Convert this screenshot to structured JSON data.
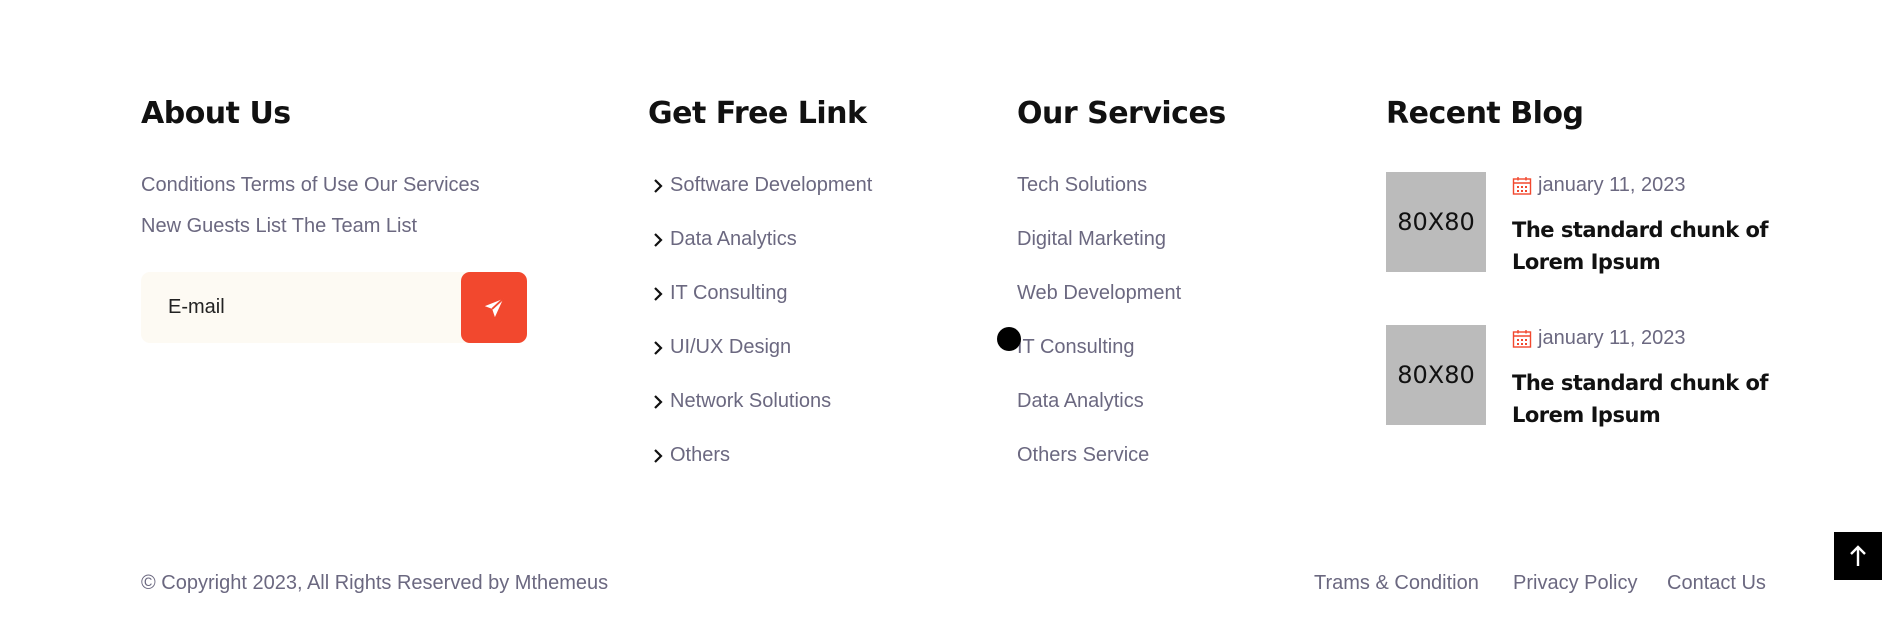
{
  "about": {
    "title": "About Us",
    "line1": "Conditions Terms of Use Our Services",
    "line2": "New Guests List The Team List",
    "email_placeholder": "E-mail"
  },
  "free_links": {
    "title": "Get Free Link",
    "items": [
      "Software Development",
      "Data Analytics",
      "IT Consulting",
      "UI/UX Design",
      "Network Solutions",
      "Others"
    ]
  },
  "services": {
    "title": "Our Services",
    "items": [
      "Tech Solutions",
      "Digital Marketing",
      "Web Development",
      "IT Consulting",
      "Data Analytics",
      "Others Service"
    ]
  },
  "blog": {
    "title": "Recent Blog",
    "posts": [
      {
        "thumb": "80X80",
        "date": "january 11, 2023",
        "title": "The standard chunk of Lorem Ipsum"
      },
      {
        "thumb": "80X80",
        "date": "january 11, 2023",
        "title": "The standard chunk of Lorem Ipsum"
      }
    ]
  },
  "footer": {
    "copyright": "© Copyright 2023, All Rights Reserved by Mthemeus",
    "links": [
      "Trams & Condition",
      "Privacy Policy",
      "Contact Us"
    ]
  },
  "colors": {
    "accent": "#f2482e",
    "heading": "#111111",
    "text": "#6b6880",
    "input_bg": "#fdfaf3"
  },
  "icons": [
    "send-icon",
    "chevron-right-icon",
    "calendar-icon",
    "arrow-up-icon"
  ]
}
